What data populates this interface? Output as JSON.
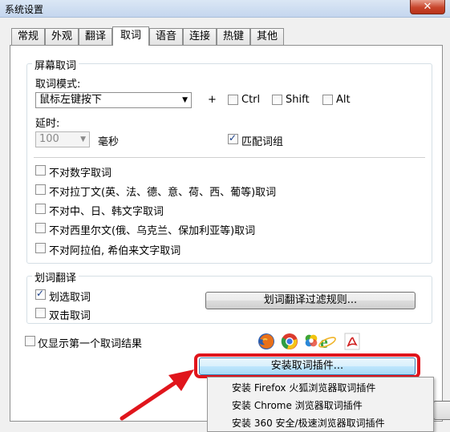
{
  "window": {
    "title": "系统设置",
    "close_label": "✕"
  },
  "tabs": [
    {
      "label": "常规"
    },
    {
      "label": "外观"
    },
    {
      "label": "翻译"
    },
    {
      "label": "取词"
    },
    {
      "label": "语音"
    },
    {
      "label": "连接"
    },
    {
      "label": "热键"
    },
    {
      "label": "其他"
    }
  ],
  "active_tab": "取词",
  "screen_capture": {
    "legend": "屏幕取词",
    "mode_label": "取词模式:",
    "mode_value": "鼠标左键按下",
    "plus": "+",
    "modifiers": [
      {
        "label": "Ctrl",
        "checked": false
      },
      {
        "label": "Shift",
        "checked": false
      },
      {
        "label": "Alt",
        "checked": false
      }
    ],
    "delay_label": "延时:",
    "delay_value": "100",
    "delay_unit": "毫秒",
    "match_phrase": {
      "label": "匹配词组",
      "checked": true
    },
    "exclusions": [
      {
        "label": "不对数字取词",
        "checked": false
      },
      {
        "label": "不对拉丁文(英、法、德、意、荷、西、葡等)取词",
        "checked": false
      },
      {
        "label": "不对中、日、韩文字取词",
        "checked": false
      },
      {
        "label": "不对西里尔文(俄、乌克兰、保加利亚等)取词",
        "checked": false
      },
      {
        "label": "不对阿拉伯, 希伯来文字取词",
        "checked": false
      }
    ]
  },
  "selection_translate": {
    "legend": "划词翻译",
    "options": [
      {
        "label": "划选取词",
        "checked": true
      },
      {
        "label": "双击取词",
        "checked": false
      }
    ],
    "filter_button": "划词翻译过滤规则..."
  },
  "only_first_result": {
    "label": "仅显示第一个取词结果",
    "checked": false
  },
  "install_button": "安装取词插件...",
  "plugin_menu": [
    "安装 Firefox 火狐浏览器取词插件",
    "安装 Chrome 浏览器取词插件",
    "安装 360 安全/极速浏览器取词插件"
  ],
  "colors": {
    "highlight": "#e0151c",
    "accent": "#3c7fb1"
  }
}
